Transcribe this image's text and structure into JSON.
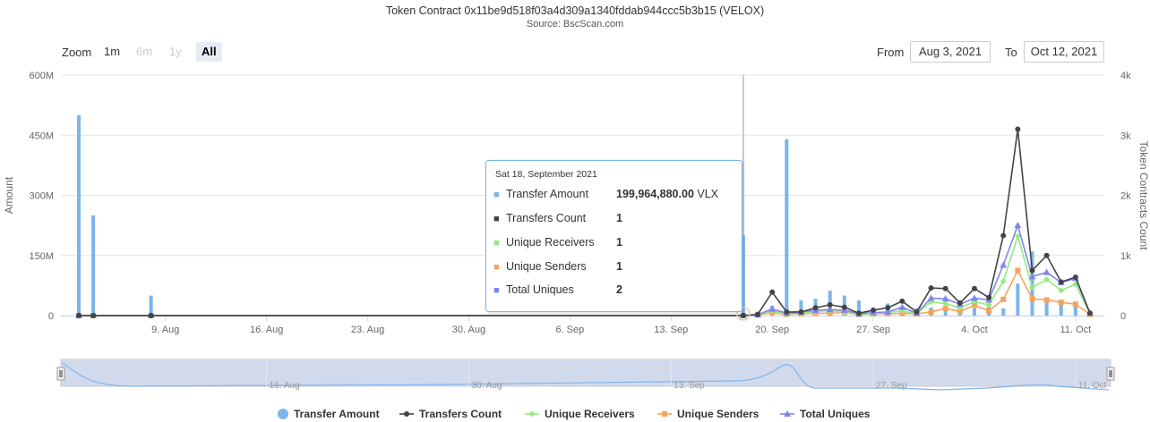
{
  "title": "Token Contract 0x11be9d518f03a4d309a1340fddab944ccc5b3b15 (VELOX)",
  "subtitle": "Source: BscScan.com",
  "zoom": {
    "label": "Zoom",
    "buttons": [
      {
        "label": "1m",
        "state": "normal"
      },
      {
        "label": "6m",
        "state": "disabled"
      },
      {
        "label": "1y",
        "state": "disabled"
      },
      {
        "label": "All",
        "state": "active"
      }
    ]
  },
  "range": {
    "from_label": "From",
    "from_value": "Aug 3, 2021",
    "to_label": "To",
    "to_value": "Oct 12, 2021"
  },
  "tooltip": {
    "date": "Sat 18, September 2021",
    "rows": [
      {
        "label": "Transfer Amount",
        "value": "199,964,880.00",
        "unit": "VLX",
        "color": "#7cb5ec",
        "symbol": "■"
      },
      {
        "label": "Transfers Count",
        "value": "1",
        "unit": "",
        "color": "#434348",
        "symbol": "■"
      },
      {
        "label": "Unique Receivers",
        "value": "1",
        "unit": "",
        "color": "#90ed7d",
        "symbol": "■"
      },
      {
        "label": "Unique Senders",
        "value": "1",
        "unit": "",
        "color": "#f7a35c",
        "symbol": "■"
      },
      {
        "label": "Total Uniques",
        "value": "2",
        "unit": "",
        "color": "#8085e9",
        "symbol": "■"
      }
    ]
  },
  "navigator": {
    "labels": [
      "16. Aug",
      "30. Aug",
      "13. Sep",
      "27. Sep",
      "11. Oct"
    ]
  },
  "chart_data": {
    "type": "bar",
    "title": "Token Contract 0x11be9d518f03a4d309a1340fddab944ccc5b3b15 (VELOX)",
    "subtitle": "Source: BscScan.com",
    "x_start": "2021-08-03",
    "x_end": "2021-10-12",
    "ylabel": "Amount",
    "y2label": "Token Contracts Count",
    "y_ticks": [
      "0",
      "150M",
      "300M",
      "450M",
      "600M"
    ],
    "y_max": 600000000,
    "y2_ticks": [
      "0",
      "1k",
      "2k",
      "3k",
      "4k"
    ],
    "y2_max": 4000,
    "x_ticks": [
      {
        "date": "2021-08-09",
        "label": "9. Aug"
      },
      {
        "date": "2021-08-16",
        "label": "16. Aug"
      },
      {
        "date": "2021-08-23",
        "label": "23. Aug"
      },
      {
        "date": "2021-08-30",
        "label": "30. Aug"
      },
      {
        "date": "2021-09-06",
        "label": "6. Sep"
      },
      {
        "date": "2021-09-13",
        "label": "13. Sep"
      },
      {
        "date": "2021-09-20",
        "label": "20. Sep"
      },
      {
        "date": "2021-09-27",
        "label": "27. Sep"
      },
      {
        "date": "2021-10-04",
        "label": "4. Oct"
      },
      {
        "date": "2021-10-11",
        "label": "11. Oct"
      }
    ],
    "grid": true,
    "legend_position": "bottom",
    "series": [
      {
        "name": "Transfer Amount",
        "kind": "bar",
        "axis": "left",
        "color": "#7cb5ec",
        "dates": [
          "2021-08-03",
          "2021-08-04",
          "2021-08-08",
          "2021-09-18",
          "2021-09-20",
          "2021-09-21",
          "2021-09-22",
          "2021-09-23",
          "2021-09-24",
          "2021-09-25",
          "2021-09-26",
          "2021-09-27",
          "2021-09-28",
          "2021-09-29",
          "2021-09-30",
          "2021-10-01",
          "2021-10-02",
          "2021-10-03",
          "2021-10-04",
          "2021-10-05",
          "2021-10-06",
          "2021-10-07",
          "2021-10-08",
          "2021-10-09",
          "2021-10-10",
          "2021-10-11",
          "2021-10-12"
        ],
        "values": [
          500000000,
          250000000,
          50000000,
          199964880,
          25000000,
          440000000,
          38000000,
          42000000,
          62000000,
          50000000,
          38000000,
          20000000,
          30000000,
          15000000,
          18000000,
          20000000,
          25000000,
          30000000,
          18000000,
          25000000,
          18000000,
          80000000,
          160000000,
          45000000,
          30000000,
          25000000,
          12000000
        ]
      },
      {
        "name": "Transfers Count",
        "kind": "line",
        "axis": "right",
        "color": "#434348",
        "marker": "circle",
        "dates": [
          "2021-08-03",
          "2021-08-04",
          "2021-08-08",
          "2021-09-18",
          "2021-09-19",
          "2021-09-20",
          "2021-09-21",
          "2021-09-22",
          "2021-09-23",
          "2021-09-24",
          "2021-09-25",
          "2021-09-26",
          "2021-09-27",
          "2021-09-28",
          "2021-09-29",
          "2021-09-30",
          "2021-10-01",
          "2021-10-02",
          "2021-10-03",
          "2021-10-04",
          "2021-10-05",
          "2021-10-06",
          "2021-10-07",
          "2021-10-08",
          "2021-10-09",
          "2021-10-10",
          "2021-10-11",
          "2021-10-12"
        ],
        "values": [
          1,
          1,
          1,
          1,
          20,
          390,
          60,
          60,
          130,
          180,
          140,
          40,
          90,
          130,
          240,
          60,
          460,
          450,
          210,
          450,
          300,
          1330,
          3100,
          750,
          1000,
          560,
          640,
          40
        ]
      },
      {
        "name": "Unique Receivers",
        "kind": "line",
        "axis": "right",
        "color": "#90ed7d",
        "marker": "diamond",
        "dates": [
          "2021-08-03",
          "2021-08-04",
          "2021-08-08",
          "2021-09-18",
          "2021-09-19",
          "2021-09-20",
          "2021-09-21",
          "2021-09-22",
          "2021-09-23",
          "2021-09-24",
          "2021-09-25",
          "2021-09-26",
          "2021-09-27",
          "2021-09-28",
          "2021-09-29",
          "2021-09-30",
          "2021-10-01",
          "2021-10-02",
          "2021-10-03",
          "2021-10-04",
          "2021-10-05",
          "2021-10-06",
          "2021-10-07",
          "2021-10-08",
          "2021-10-09",
          "2021-10-10",
          "2021-10-11",
          "2021-10-12"
        ],
        "values": [
          1,
          1,
          1,
          1,
          15,
          80,
          25,
          40,
          70,
          80,
          60,
          20,
          30,
          50,
          80,
          30,
          230,
          200,
          130,
          230,
          180,
          570,
          1320,
          470,
          600,
          420,
          520,
          30
        ]
      },
      {
        "name": "Unique Senders",
        "kind": "line",
        "axis": "right",
        "color": "#f7a35c",
        "marker": "square",
        "dates": [
          "2021-08-03",
          "2021-08-04",
          "2021-08-08",
          "2021-09-18",
          "2021-09-19",
          "2021-09-20",
          "2021-09-21",
          "2021-09-22",
          "2021-09-23",
          "2021-09-24",
          "2021-09-25",
          "2021-09-26",
          "2021-09-27",
          "2021-09-28",
          "2021-09-29",
          "2021-09-30",
          "2021-10-01",
          "2021-10-02",
          "2021-10-03",
          "2021-10-04",
          "2021-10-05",
          "2021-10-06",
          "2021-10-07",
          "2021-10-08",
          "2021-10-09",
          "2021-10-10",
          "2021-10-11",
          "2021-10-12"
        ],
        "values": [
          1,
          1,
          1,
          1,
          10,
          50,
          20,
          30,
          40,
          40,
          50,
          20,
          30,
          30,
          40,
          30,
          60,
          120,
          70,
          170,
          80,
          270,
          750,
          280,
          260,
          220,
          190,
          20
        ]
      },
      {
        "name": "Total Uniques",
        "kind": "line",
        "axis": "right",
        "color": "#8085e9",
        "marker": "triangle",
        "dates": [
          "2021-08-03",
          "2021-08-04",
          "2021-08-08",
          "2021-09-18",
          "2021-09-19",
          "2021-09-20",
          "2021-09-21",
          "2021-09-22",
          "2021-09-23",
          "2021-09-24",
          "2021-09-25",
          "2021-09-26",
          "2021-09-27",
          "2021-09-28",
          "2021-09-29",
          "2021-09-30",
          "2021-10-01",
          "2021-10-02",
          "2021-10-03",
          "2021-10-04",
          "2021-10-05",
          "2021-10-06",
          "2021-10-07",
          "2021-10-08",
          "2021-10-09",
          "2021-10-10",
          "2021-10-11",
          "2021-10-12"
        ],
        "values": [
          2,
          2,
          2,
          2,
          15,
          110,
          40,
          60,
          90,
          100,
          90,
          30,
          50,
          60,
          140,
          40,
          290,
          280,
          190,
          290,
          260,
          840,
          1500,
          650,
          720,
          550,
          620,
          40
        ]
      }
    ]
  }
}
